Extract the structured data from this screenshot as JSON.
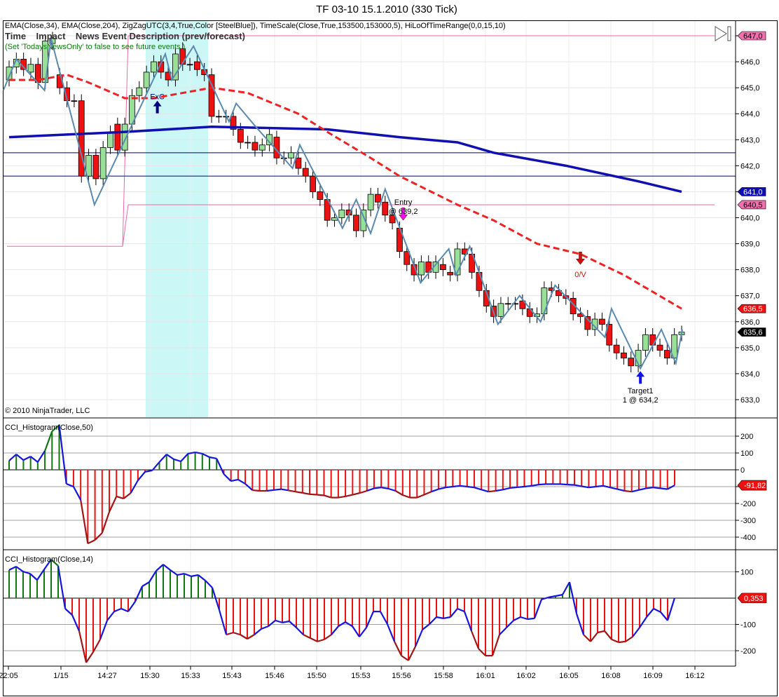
{
  "window": {
    "title": "TF 03-10  15.1.2010 (330 Tick)"
  },
  "header": {
    "indicators": "EMA(Close,34), EMA(Close,204), ZigZagUTC(3,4,True,Color [SteelBlue]), TimeScale(Close,True,153500,153000,5), HiLoOfTimeRange(0,0,15,10)",
    "news_columns": "Time    Impact    News Event Description (prev/forecast)",
    "news_note": "(Set 'TodaysNewsOnly' to false to see future events.)"
  },
  "copyright": "© 2010 NinjaTrader, LLC",
  "colors": {
    "up": "#98e098",
    "down": "#ee1111",
    "ema34": "#ee2222",
    "ema204": "#1010b0",
    "zigzag": "#5a8ab0",
    "news_band": "#ccf7f7",
    "hilo": "#ee66aa",
    "levels": "#000080"
  },
  "chart_data": [
    {
      "type": "candlestick",
      "title": "TF 03-10 (330 Tick)",
      "ylim": [
        632.6,
        647.3
      ],
      "yticks": [
        "647,0",
        "646,0",
        "645,0",
        "644,0",
        "643,0",
        "642,0",
        "641,0",
        "640,0",
        "639,0",
        "638,0",
        "637,0",
        "636,0",
        "635,0",
        "634,0",
        "633,0"
      ],
      "ytick_values": [
        647,
        646,
        645,
        644,
        643,
        642,
        641,
        640,
        639,
        638,
        637,
        636,
        635,
        634,
        633
      ],
      "xticks": [
        "22:05",
        "1/15",
        "14:27",
        "15:30",
        "15:33",
        "15:43",
        "15:46",
        "15:50",
        "15:53",
        "15:56",
        "15:58",
        "16:01",
        "16:02",
        "16:05",
        "16:08",
        "16:09",
        "16:12"
      ],
      "bars_oc": [
        [
          645.3,
          645.8
        ],
        [
          645.8,
          646.1
        ],
        [
          646.1,
          645.7
        ],
        [
          645.6,
          645.9
        ],
        [
          645.9,
          645.2
        ],
        [
          645.2,
          646.8
        ],
        [
          646.7,
          646.9
        ],
        [
          645.5,
          645.0
        ],
        [
          645.0,
          644.5
        ],
        [
          644.5,
          644.5
        ],
        [
          644.5,
          641.6
        ],
        [
          641.6,
          642.4
        ],
        [
          642.4,
          641.5
        ],
        [
          641.5,
          642.7
        ],
        [
          642.7,
          643.3
        ],
        [
          643.6,
          642.6
        ],
        [
          642.6,
          643.6
        ],
        [
          643.6,
          644.7
        ],
        [
          644.7,
          645.0
        ],
        [
          645.0,
          645.6
        ],
        [
          645.6,
          646.0
        ],
        [
          646.0,
          645.6
        ],
        [
          645.6,
          645.3
        ],
        [
          645.3,
          646.3
        ],
        [
          646.5,
          645.9
        ],
        [
          645.9,
          645.9
        ],
        [
          646.0,
          645.7
        ],
        [
          645.7,
          645.5
        ],
        [
          645.5,
          643.9
        ],
        [
          643.9,
          643.9
        ],
        [
          643.9,
          643.9
        ],
        [
          643.9,
          643.4
        ],
        [
          643.4,
          642.9
        ],
        [
          642.9,
          642.9
        ],
        [
          642.9,
          642.6
        ],
        [
          642.6,
          642.8
        ],
        [
          642.8,
          643.2
        ],
        [
          643.1,
          642.3
        ],
        [
          642.3,
          642.3
        ],
        [
          642.3,
          642.5
        ],
        [
          642.3,
          641.9
        ],
        [
          641.9,
          641.6
        ],
        [
          641.6,
          641.0
        ],
        [
          641.0,
          640.7
        ],
        [
          640.7,
          639.9
        ],
        [
          639.9,
          640.0
        ],
        [
          640.0,
          640.3
        ],
        [
          640.3,
          640.1
        ],
        [
          640.1,
          639.5
        ],
        [
          639.5,
          640.3
        ],
        [
          640.3,
          640.9
        ],
        [
          640.9,
          640.6
        ],
        [
          640.6,
          640.1
        ],
        [
          640.1,
          639.8
        ],
        [
          639.6,
          638.7
        ],
        [
          638.7,
          638.2
        ],
        [
          638.2,
          637.8
        ],
        [
          637.8,
          638.3
        ],
        [
          638.3,
          637.9
        ],
        [
          637.9,
          638.3
        ],
        [
          638.2,
          638.0
        ],
        [
          637.9,
          637.8
        ],
        [
          637.8,
          638.8
        ],
        [
          638.8,
          638.6
        ],
        [
          638.6,
          637.9
        ],
        [
          637.9,
          637.2
        ],
        [
          637.2,
          636.6
        ],
        [
          636.6,
          636.2
        ],
        [
          636.2,
          636.7
        ],
        [
          636.7,
          636.7
        ],
        [
          636.7,
          636.7
        ],
        [
          636.8,
          636.5
        ],
        [
          636.5,
          636.2
        ],
        [
          636.2,
          636.3
        ],
        [
          636.3,
          637.3
        ],
        [
          637.3,
          637.2
        ],
        [
          637.2,
          637.0
        ],
        [
          637.0,
          636.9
        ],
        [
          636.9,
          636.3
        ],
        [
          636.3,
          636.2
        ],
        [
          636.2,
          635.7
        ],
        [
          635.7,
          636.1
        ],
        [
          636.1,
          635.9
        ],
        [
          635.9,
          635.1
        ],
        [
          635.1,
          634.8
        ],
        [
          634.8,
          634.6
        ],
        [
          634.6,
          634.3
        ],
        [
          634.3,
          634.9
        ],
        [
          634.9,
          635.5
        ],
        [
          635.5,
          635.1
        ],
        [
          635.1,
          634.9
        ],
        [
          634.9,
          634.6
        ],
        [
          634.6,
          635.5
        ],
        [
          635.5,
          635.6
        ]
      ],
      "ema34": [
        [
          0,
          645.3
        ],
        [
          4,
          645.3
        ],
        [
          8,
          645.5
        ],
        [
          11,
          645.2
        ],
        [
          16,
          644.6
        ],
        [
          20,
          644.6
        ],
        [
          28,
          645.0
        ],
        [
          33,
          644.8
        ],
        [
          40,
          644.0
        ],
        [
          44,
          643.3
        ],
        [
          50,
          642.3
        ],
        [
          54,
          641.6
        ],
        [
          62,
          640.5
        ],
        [
          67,
          639.9
        ],
        [
          73,
          639.0
        ],
        [
          79,
          638.6
        ],
        [
          85,
          637.8
        ],
        [
          93,
          636.5
        ]
      ],
      "ema204": [
        [
          0,
          643.1
        ],
        [
          16,
          643.3
        ],
        [
          28,
          643.5
        ],
        [
          44,
          643.4
        ],
        [
          54,
          643.1
        ],
        [
          62,
          642.9
        ],
        [
          67,
          642.5
        ],
        [
          77,
          642.0
        ],
        [
          87,
          641.4
        ],
        [
          93,
          641.0
        ]
      ],
      "zigzag": [
        [
          -0.8,
          644.9
        ],
        [
          1,
          646.1
        ],
        [
          4.9,
          644.9
        ],
        [
          5.8,
          646.9
        ],
        [
          11.8,
          640.5
        ],
        [
          21.6,
          646.3
        ],
        [
          22.5,
          645.3
        ],
        [
          25.5,
          646.6
        ],
        [
          30.4,
          643.7
        ],
        [
          31.4,
          644.4
        ],
        [
          33.8,
          643.6
        ],
        [
          39.2,
          641.9
        ],
        [
          40.2,
          642.8
        ],
        [
          46.1,
          639.6
        ],
        [
          48,
          640.7
        ],
        [
          50,
          639.4
        ],
        [
          52,
          641.1
        ],
        [
          56.9,
          637.5
        ],
        [
          60.8,
          638.8
        ],
        [
          61.8,
          637.8
        ],
        [
          63.7,
          638.9
        ],
        [
          67.6,
          635.9
        ],
        [
          70.6,
          637.0
        ],
        [
          73.5,
          636.0
        ],
        [
          75.5,
          637.4
        ],
        [
          82.4,
          635.4
        ],
        [
          83.3,
          636.5
        ],
        [
          87.3,
          634.2
        ],
        [
          90.2,
          635.7
        ],
        [
          92.2,
          634.4
        ],
        [
          93.1,
          635.7
        ]
      ],
      "levels": [
        642.5,
        641.6
      ],
      "hilo": {
        "high": 647.0,
        "low": 640.5,
        "prior_low": 638.9
      },
      "price_tags": [
        {
          "label": "647,0",
          "value": 647.0,
          "color": "#f070b0",
          "text": "#000"
        },
        {
          "label": "641,0",
          "value": 641.0,
          "color": "#1010b0",
          "text": "#fff"
        },
        {
          "label": "640,5",
          "value": 640.5,
          "color": "#f070b0",
          "text": "#000"
        },
        {
          "label": "636,5",
          "value": 636.5,
          "color": "#ee1111",
          "text": "#fff"
        },
        {
          "label": "635,6",
          "value": 635.6,
          "color": "#000000",
          "text": "#fff"
        }
      ],
      "annotations": [
        {
          "id": "exc",
          "text": "ExC",
          "bar": 20.5,
          "value": 644.5,
          "arrow": "up",
          "color": "#000080"
        },
        {
          "id": "entry",
          "text": "Entry",
          "text2": "@ 639,2",
          "bar": 54.5,
          "value": 639.9,
          "arrow": "down",
          "color": "#ee11ee"
        },
        {
          "id": "ov",
          "text": "0/V",
          "bar": 79,
          "value": 638.2,
          "arrow": "down",
          "color": "#cc1111"
        },
        {
          "id": "target",
          "text": "Target1",
          "text2": "1 @ 634,2",
          "bar": 87.3,
          "value": 634.1,
          "arrow": "up",
          "color": "#1111ee"
        }
      ]
    },
    {
      "type": "histogram",
      "title": "CCI_Histogram(Close,50)",
      "ylim": [
        -440,
        260
      ],
      "yticks": [
        "200",
        "100",
        "0",
        "-100",
        "-200",
        "-300",
        "-400"
      ],
      "ytick_values": [
        200,
        100,
        0,
        -100,
        -200,
        -300,
        -400
      ],
      "last_value_label": "-91,82",
      "values": [
        54,
        92,
        58,
        79,
        46,
        112,
        229,
        266,
        -83,
        -100,
        -179,
        -438,
        -417,
        -375,
        -250,
        -158,
        -171,
        -138,
        -63,
        -12,
        -4,
        46,
        92,
        63,
        50,
        96,
        104,
        96,
        75,
        67,
        -25,
        -67,
        -58,
        -83,
        -121,
        -125,
        -125,
        -120,
        -115,
        -122,
        -130,
        -137,
        -145,
        -148,
        -152,
        -165,
        -165,
        -158,
        -148,
        -138,
        -125,
        -110,
        -105,
        -112,
        -125,
        -150,
        -165,
        -165,
        -148,
        -130,
        -115,
        -105,
        -100,
        -95,
        -100,
        -105,
        -118,
        -130,
        -125,
        -118,
        -108,
        -104,
        -100,
        -95,
        -88,
        -85,
        -85,
        -85,
        -88,
        -90,
        -98,
        -105,
        -100,
        -95,
        -105,
        -115,
        -125,
        -130,
        -120,
        -110,
        -105,
        -110,
        -115,
        -92
      ]
    },
    {
      "type": "histogram",
      "title": "CCI_Histogram(Close,14)",
      "ylim": [
        -260,
        160
      ],
      "yticks": [
        "100",
        "-100",
        "-200"
      ],
      "ytick_values": [
        100,
        -100,
        -200
      ],
      "last_value_label": "0,353",
      "values": [
        107,
        120,
        101,
        93,
        69,
        109,
        147,
        123,
        -40,
        -64,
        -125,
        -245,
        -205,
        -157,
        -85,
        -51,
        -40,
        -51,
        -13,
        45,
        61,
        104,
        128,
        107,
        88,
        93,
        83,
        88,
        67,
        40,
        -45,
        -139,
        -131,
        -139,
        -155,
        -139,
        -117,
        -107,
        -85,
        -93,
        -88,
        -112,
        -139,
        -152,
        -165,
        -157,
        -139,
        -107,
        -91,
        -107,
        -147,
        -112,
        -51,
        -51,
        -99,
        -165,
        -219,
        -237,
        -184,
        -120,
        -99,
        -72,
        -77,
        -72,
        -40,
        -51,
        -125,
        -192,
        -219,
        -219,
        -139,
        -112,
        -85,
        -72,
        -80,
        -77,
        -5,
        3,
        8,
        13,
        61,
        -59,
        -139,
        -165,
        -131,
        -125,
        -157,
        -168,
        -165,
        -147,
        -112,
        -72,
        -40,
        -53,
        -85,
        0.35
      ]
    }
  ]
}
